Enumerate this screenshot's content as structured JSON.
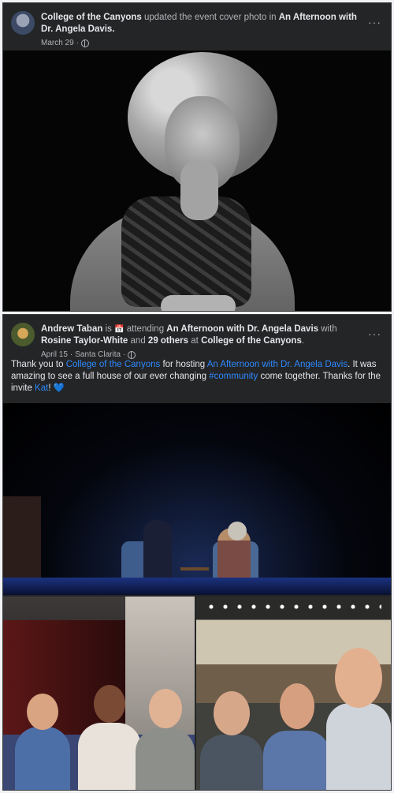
{
  "post1": {
    "actor": "College of the Canyons",
    "action": "updated the event cover photo in",
    "event": "An Afternoon with Dr. Angela Davis.",
    "date": "March 29",
    "sep": "·",
    "more": "···"
  },
  "post2": {
    "actor": "Andrew Taban",
    "is": "is",
    "activity_icon": "📅",
    "activity": "attending",
    "event": "An Afternoon with Dr. Angela Davis",
    "with": "with",
    "tagged1": "Rosine Taylor-White",
    "and": "and",
    "others": "29 others",
    "at": "at",
    "place": "College of the Canyons",
    "period": ".",
    "date": "April 15",
    "sep1": "·",
    "location": "Santa Clarita",
    "sep2": "·",
    "more": "···",
    "text": {
      "t1": "Thank you to ",
      "link1": "College of the Canyons",
      "t2": " for hosting ",
      "link2": "An Afternoon with Dr. Angela Davis",
      "t3": ". It was amazing to see a full house of our ever changing ",
      "link3": "#community",
      "t4": " come together. Thanks for the invite ",
      "link4": "Kat",
      "t5": "! ",
      "emoji": "💙"
    }
  },
  "colors": {
    "card": "#242526",
    "text": "#e4e6eb",
    "secondary": "#b0b3b8",
    "link": "#2e89ff"
  }
}
